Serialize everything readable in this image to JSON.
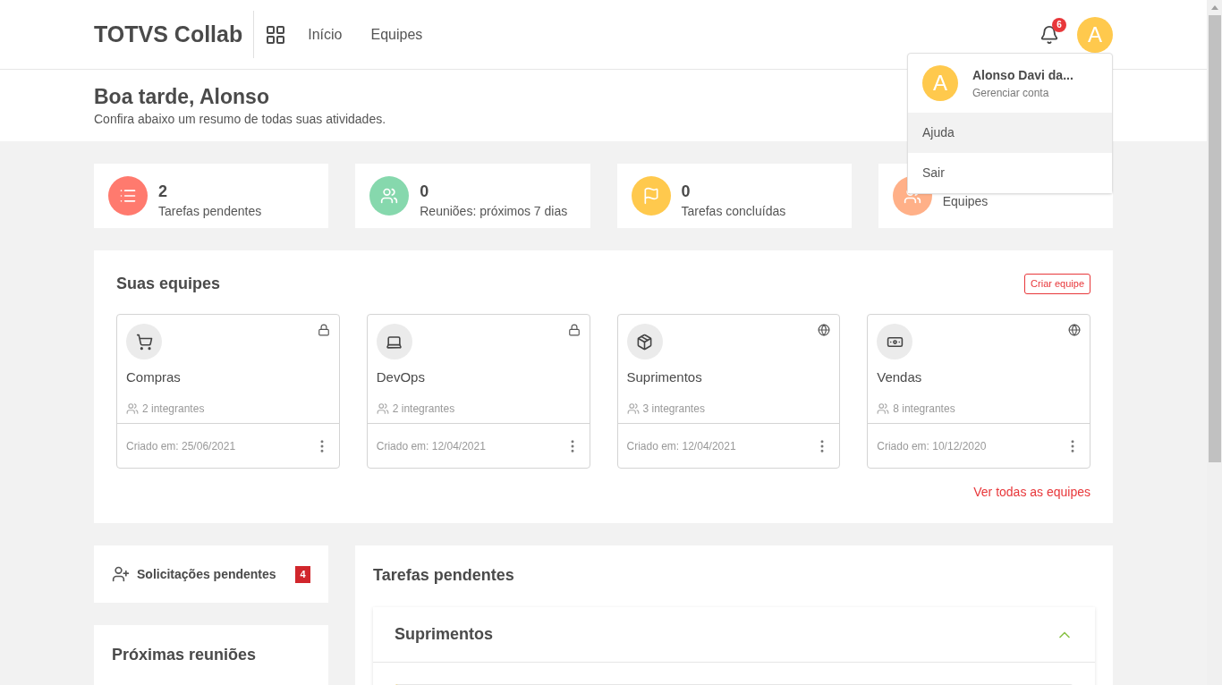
{
  "header": {
    "brand": "TOTVS Collab",
    "nav": [
      {
        "label": "Início"
      },
      {
        "label": "Equipes"
      }
    ],
    "notifications": "6",
    "avatar": "A"
  },
  "greeting": {
    "title": "Boa tarde, Alonso",
    "subtitle": "Confira abaixo um resumo de todas suas atividades."
  },
  "stats": [
    {
      "kind": "tasks",
      "color": "#ff7a6e",
      "value": "2",
      "label": "Tarefas pendentes"
    },
    {
      "kind": "meetings",
      "color": "#86d8ad",
      "value": "0",
      "label": "Reuniões: próximos 7 dias"
    },
    {
      "kind": "done",
      "color": "#ffc94d",
      "value": "0",
      "label": "Tarefas concluídas"
    },
    {
      "kind": "teams",
      "color": "#ffb088",
      "label": "Equipes"
    }
  ],
  "teams_panel": {
    "title": "Suas equipes",
    "create": "Criar equipe",
    "link": "Ver todas as equipes",
    "teams": [
      {
        "private": true,
        "name": "Compras",
        "members": "2 integrantes",
        "created": "Criado em: 25/06/2021"
      },
      {
        "private": true,
        "name": "DevOps",
        "members": "2 integrantes",
        "created": "Criado em: 12/04/2021"
      },
      {
        "private": false,
        "name": "Suprimentos",
        "members": "3 integrantes",
        "created": "Criado em: 12/04/2021"
      },
      {
        "private": false,
        "name": "Vendas",
        "members": "8 integrantes",
        "created": "Criado em: 10/12/2020"
      }
    ]
  },
  "requests": {
    "label": "Solicitações pendentes",
    "count": "4"
  },
  "meetings": {
    "title": "Próximas reuniões"
  },
  "tasks": {
    "title": "Tarefas pendentes",
    "groups": [
      {
        "name": "Suprimentos",
        "expanded": true
      }
    ]
  },
  "account_menu": {
    "avatar": "A",
    "name": "Alonso Davi da...",
    "manage": "Gerenciar conta",
    "items": [
      {
        "label": "Ajuda",
        "selected": true
      },
      {
        "label": "Sair",
        "selected": false
      }
    ]
  }
}
